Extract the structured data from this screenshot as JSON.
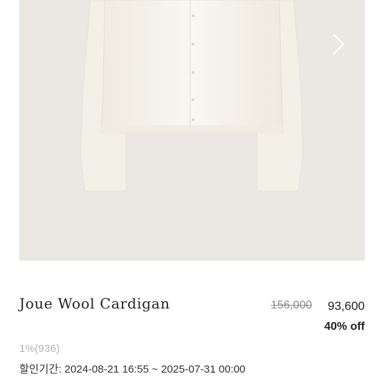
{
  "product": {
    "name": "Joue Wool Cardigan",
    "original_price": "156,000",
    "sale_price": "93,600",
    "discount": "40% off",
    "rating": "1%(936)",
    "sale_period_label": "할인기간:",
    "sale_period": "2024-08-21 16:55 ~ 2025-07-31 00:00"
  },
  "icons": {
    "next": "chevron-right-icon"
  },
  "colors": {
    "image_background": "#ebe8e3",
    "cardigan": "#f7f4ec",
    "text": "#222222",
    "muted": "#8a8a8a"
  }
}
